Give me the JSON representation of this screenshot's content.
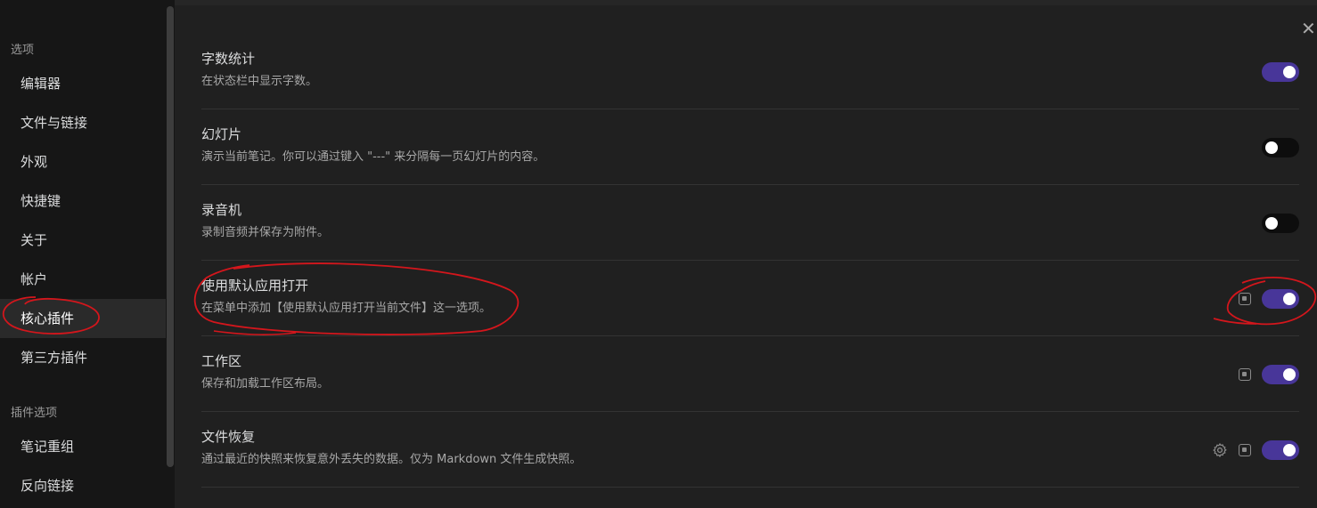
{
  "sidebar": {
    "section_options": "选项",
    "items": [
      {
        "label": "编辑器"
      },
      {
        "label": "文件与链接"
      },
      {
        "label": "外观"
      },
      {
        "label": "快捷键"
      },
      {
        "label": "关于"
      },
      {
        "label": "帐户"
      },
      {
        "label": "核心插件"
      },
      {
        "label": "第三方插件"
      }
    ],
    "section_plugin_options": "插件选项",
    "plugin_items": [
      {
        "label": "笔记重组"
      },
      {
        "label": "反向链接"
      }
    ],
    "active_item": "核心插件"
  },
  "settings": [
    {
      "name": "字数统计",
      "desc": "在状态栏中显示字数。",
      "enabled": true
    },
    {
      "name": "幻灯片",
      "desc": "演示当前笔记。你可以通过键入 \"---\" 来分隔每一页幻灯片的内容。",
      "enabled": false
    },
    {
      "name": "录音机",
      "desc": "录制音频并保存为附件。",
      "enabled": false
    },
    {
      "name": "使用默认应用打开",
      "desc": "在菜单中添加【使用默认应用打开当前文件】这一选项。",
      "enabled": true
    },
    {
      "name": "工作区",
      "desc": "保存和加载工作区布局。",
      "enabled": true
    },
    {
      "name": "文件恢复",
      "desc": "通过最近的快照来恢复意外丢失的数据。仅为 Markdown 文件生成快照。",
      "enabled": true
    }
  ],
  "icons": {
    "close": "close-icon",
    "hotkey": "hotkey-icon",
    "settings": "gear-icon"
  },
  "colors": {
    "accent": "#483699",
    "annotation": "#d4161c"
  }
}
